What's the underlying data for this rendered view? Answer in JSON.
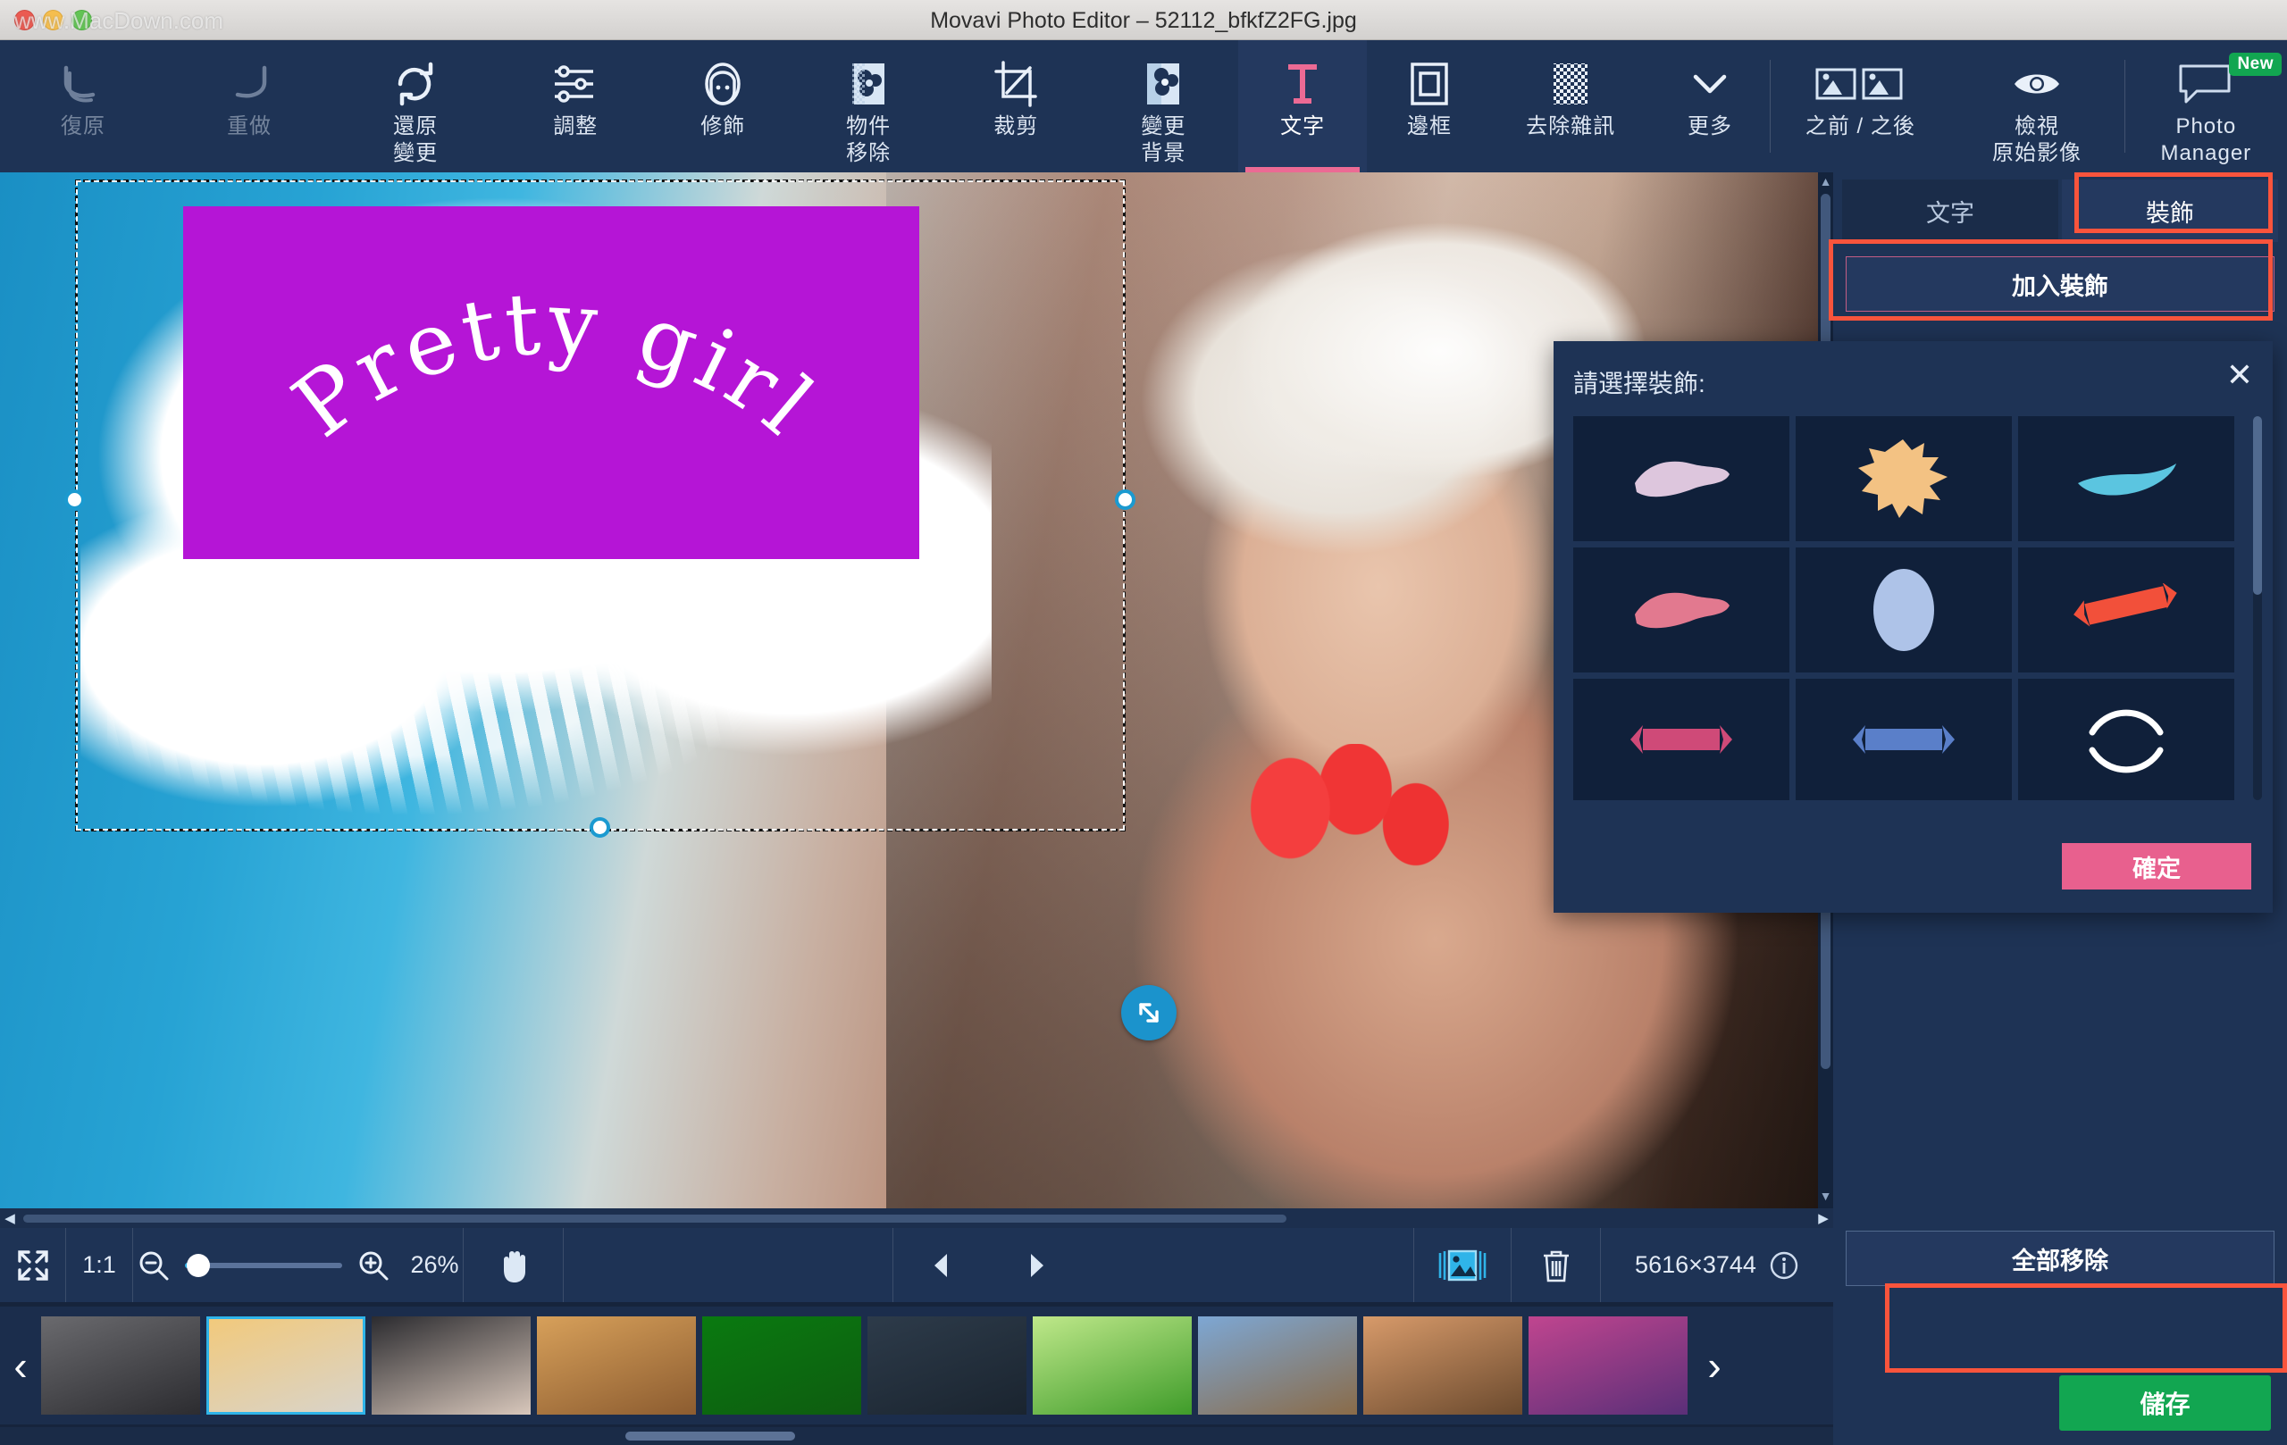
{
  "window": {
    "title": "Movavi Photo Editor – 52112_bfkfZ2FG.jpg",
    "watermark": "www.MacDown.com"
  },
  "toolbar": {
    "items": [
      {
        "label": "復原",
        "icon": "undo-icon",
        "state": "disabled"
      },
      {
        "label": "重做",
        "icon": "redo-icon",
        "state": "disabled"
      },
      {
        "label": "還原\n變更",
        "icon": "reset-changes-icon",
        "state": "normal"
      },
      {
        "label": "調整",
        "icon": "adjust-sliders-icon",
        "state": "normal"
      },
      {
        "label": "修飾",
        "icon": "retouch-face-icon",
        "state": "normal"
      },
      {
        "label": "物件\n移除",
        "icon": "object-removal-icon",
        "state": "normal"
      },
      {
        "label": "裁剪",
        "icon": "crop-icon",
        "state": "normal"
      },
      {
        "label": "變更\n背景",
        "icon": "change-background-icon",
        "state": "normal"
      },
      {
        "label": "文字",
        "icon": "text-icon",
        "state": "active"
      },
      {
        "label": "邊框",
        "icon": "frame-icon",
        "state": "normal"
      },
      {
        "label": "去除雜訊",
        "icon": "denoise-icon",
        "state": "normal"
      },
      {
        "label": "更多",
        "icon": "chevron-down-icon",
        "state": "normal"
      }
    ],
    "right_items": [
      {
        "label": "之前 / 之後",
        "icon": "before-after-icon"
      },
      {
        "label": "檢視\n原始影像",
        "icon": "eye-icon"
      },
      {
        "label": "Photo\nManager",
        "icon": "speech-bubble-icon",
        "badge": "New"
      }
    ]
  },
  "canvas": {
    "overlay_text": "Pretty girl",
    "text_box_color": "#b515d6",
    "text_color": "#ffffff"
  },
  "bottombar": {
    "fit_icon": "fit-to-screen-icon",
    "one_to_one": "1:1",
    "zoom_out_icon": "zoom-out-icon",
    "zoom_in_icon": "zoom-in-icon",
    "zoom_value": "26%",
    "hand_icon": "hand-tool-icon",
    "prev_icon": "previous-arrow-icon",
    "next_icon": "next-arrow-icon",
    "gallery_icon": "gallery-icon",
    "delete_icon": "trash-icon",
    "dimensions": "5616×3744",
    "info_icon": "info-icon"
  },
  "filmstrip": {
    "prev_icon": "chevron-left-icon",
    "next_icon": "chevron-right-icon",
    "thumbs": [
      {
        "name": "thumb-gym-workout",
        "c1": "#6a6a6e",
        "c2": "#2c2c30"
      },
      {
        "name": "thumb-pasta-plate",
        "c1": "#f2c97a",
        "c2": "#d8d4cc"
      },
      {
        "name": "thumb-wedding-roses",
        "c1": "#2b2b2f",
        "c2": "#d8c7bb"
      },
      {
        "name": "thumb-burger-drink",
        "c1": "#d7a05a",
        "c2": "#8c5c30"
      },
      {
        "name": "thumb-green-leaf",
        "c1": "#0a7a10",
        "c2": "#0e5c10"
      },
      {
        "name": "thumb-dumbbell-man",
        "c1": "#2d3b4a",
        "c2": "#1a242f"
      },
      {
        "name": "thumb-green-plants",
        "c1": "#bfe88a",
        "c2": "#3f9c2a"
      },
      {
        "name": "thumb-ancient-ruins",
        "c1": "#7da7d4",
        "c2": "#8a6b48"
      },
      {
        "name": "thumb-chinese-temple",
        "c1": "#d79a6a",
        "c2": "#6b4a2e"
      },
      {
        "name": "thumb-purple-sunset",
        "c1": "#c0458f",
        "c2": "#5a2f78"
      }
    ]
  },
  "rightpanel": {
    "tabs": [
      {
        "label": "文字",
        "active": false
      },
      {
        "label": "裝飾",
        "active": true
      }
    ],
    "add_decoration": "加入裝飾",
    "remove_all": "全部移除",
    "save": "儲存"
  },
  "dialog": {
    "title": "請選擇裝飾:",
    "close_icon": "close-icon",
    "ok": "確定",
    "items": [
      {
        "name": "decor-lilac-brush",
        "color": "#ddc6dd",
        "shape": "brush"
      },
      {
        "name": "decor-orange-splat",
        "color": "#f3c283",
        "shape": "splat"
      },
      {
        "name": "decor-cyan-stroke",
        "color": "#5bc5e0",
        "shape": "stroke"
      },
      {
        "name": "decor-pink-brush",
        "color": "#e2798f",
        "shape": "brush"
      },
      {
        "name": "decor-blue-blob",
        "color": "#aec3e8",
        "shape": "blob"
      },
      {
        "name": "decor-red-ribbon-banner",
        "color": "#f2503a",
        "shape": "ribbon-tilt"
      },
      {
        "name": "decor-pink-ribbon-banner",
        "color": "#cf4a78",
        "shape": "ribbon"
      },
      {
        "name": "decor-blue-ribbon-banner",
        "color": "#5a7fc9",
        "shape": "ribbon"
      },
      {
        "name": "decor-white-laurel-circle",
        "color": "#ffffff",
        "shape": "arc"
      },
      {
        "name": "decor-green-arc",
        "color": "#2f6b4f",
        "shape": "arc-half"
      },
      {
        "name": "decor-white-arc",
        "color": "#ffffff",
        "shape": "arc-half"
      },
      {
        "name": "decor-blue-arc",
        "color": "#4a6fc0",
        "shape": "arc-half"
      }
    ]
  }
}
